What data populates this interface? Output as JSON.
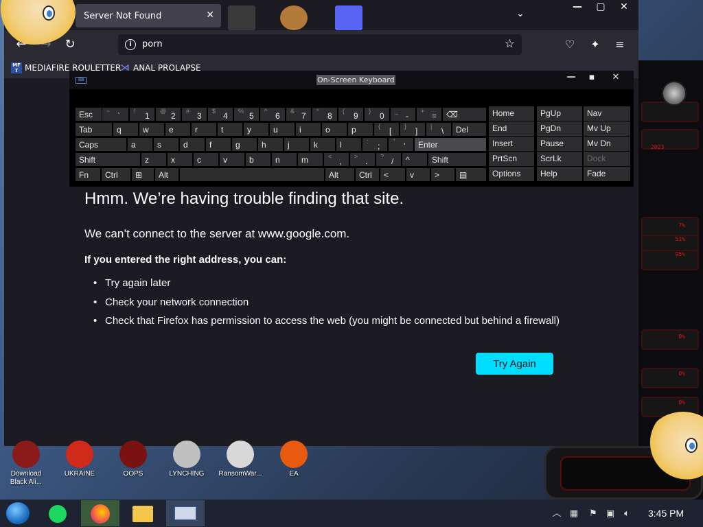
{
  "browser": {
    "tab_title": "Server Not Found",
    "tab_close": "✕",
    "new_tab": "+",
    "tablist": "⌄",
    "win_min": "—",
    "win_max": "▢",
    "win_close": "✕",
    "url": "porn",
    "bookmarks": [
      {
        "label": "MEDIAFIRE ROULETTER",
        "icon": "MF\nT"
      },
      {
        "label": "ANAL PROLAPSE",
        "icon": "⋊"
      }
    ]
  },
  "error": {
    "title": "Hmm. We’re having trouble finding that site.",
    "subtitle": "We can’t connect to the server at www.google.com.",
    "lead": "If you entered the right address, you can:",
    "items": [
      "Try again later",
      "Check your network connection",
      "Check that Firefox has permission to access the web (you might be connected but behind a firewall)"
    ],
    "button": "Try Again"
  },
  "osk": {
    "title": "On-Screen Keyboard",
    "rows": {
      "r1": [
        "Esc",
        "~ `",
        "! 1",
        "@ 2",
        "# 3",
        "$ 4",
        "% 5",
        "^ 6",
        "& 7",
        "* 8",
        "( 9",
        ") 0",
        "_ -",
        "+ =",
        "⌫"
      ],
      "r2": [
        "Tab",
        "q",
        "w",
        "e",
        "r",
        "t",
        "y",
        "u",
        "i",
        "o",
        "p",
        "{ [",
        "} ]",
        "| \\",
        "Del"
      ],
      "r3": [
        "Caps",
        "a",
        "s",
        "d",
        "f",
        "g",
        "h",
        "j",
        "k",
        "l",
        ": ;",
        "\" '",
        "Enter"
      ],
      "r4": [
        "Shift",
        "z",
        "x",
        "c",
        "v",
        "b",
        "n",
        "m",
        "< ,",
        "> .",
        "? /",
        "^",
        "Shift"
      ],
      "r5": [
        "Fn",
        "Ctrl",
        "⊞",
        "Alt",
        "",
        "Alt",
        "Ctrl",
        "<",
        "v",
        ">",
        "▤"
      ]
    },
    "nav": [
      [
        "Home",
        "PgUp",
        "Nav"
      ],
      [
        "End",
        "PgDn",
        "Mv Up"
      ],
      [
        "Insert",
        "Pause",
        "Mv Dn"
      ],
      [
        "PrtScn",
        "ScrLk",
        "Dock"
      ],
      [
        "Options",
        "Help",
        "Fade"
      ]
    ]
  },
  "desktop_icons": [
    {
      "label": "Download Black Ali...",
      "color": "#8b1a1a"
    },
    {
      "label": "UKRAINE",
      "color": "#d02a1a"
    },
    {
      "label": "OOPS",
      "color": "#7a1212"
    },
    {
      "label": "LYNCHING",
      "color": "#c0c0c0"
    },
    {
      "label": "RansomWar...",
      "color": "#d8d8d8"
    },
    {
      "label": "EA",
      "color": "#e85a10"
    }
  ],
  "deco_numbers": [
    "7%",
    "51%",
    "95%",
    "0%",
    "0%",
    "0%"
  ],
  "deco_text": "2023",
  "taskbar": {
    "clock": "3:45 PM"
  }
}
